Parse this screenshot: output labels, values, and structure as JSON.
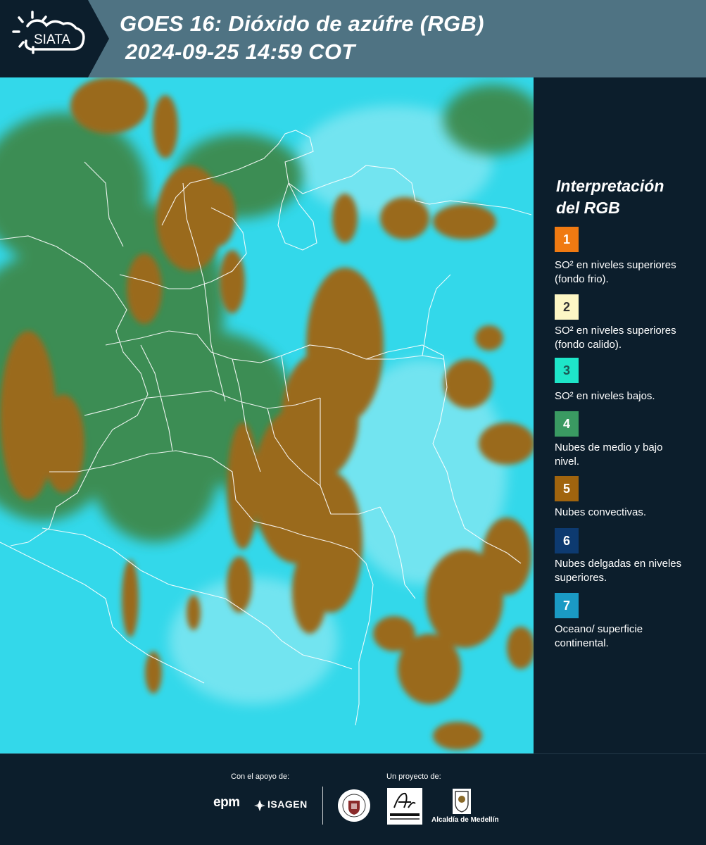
{
  "header": {
    "logo_text": "SIATA",
    "title_line1": "GOES 16: Dióxido de azúfre (RGB)",
    "title_line2": "2024-09-25 14:59 COT",
    "background_color": "#4f7383",
    "tab_color": "#0c1e2c"
  },
  "legend": {
    "title_line1": "Interpretación",
    "title_line2": "del RGB",
    "items": [
      {
        "number": "1",
        "label": "SO² en niveles superiores (fondo frio).",
        "color": "#f07a12",
        "text_color": "#ffffff"
      },
      {
        "number": "2",
        "label": "SO² en niveles superiores (fondo calido).",
        "color": "#fdf7c5",
        "text_color": "#333333"
      },
      {
        "number": "3",
        "label": "SO² en niveles bajos.",
        "color": "#1ee6c9",
        "text_color": "#1b5a55"
      },
      {
        "number": "4",
        "label": "Nubes de medio y bajo nivel.",
        "color": "#3a9a62",
        "text_color": "#ffffff"
      },
      {
        "number": "5",
        "label": "Nubes convectivas.",
        "color": "#a0640e",
        "text_color": "#ffffff"
      },
      {
        "number": "6",
        "label": "Nubes delgadas en niveles superiores.",
        "color": "#0d3a70",
        "text_color": "#ffffff"
      },
      {
        "number": "7",
        "label": "Oceano/ superficie continental.",
        "color": "#1a9ac4",
        "text_color": "#ffffff"
      }
    ]
  },
  "map": {
    "ocean_color": "#33d8ea",
    "convective_color": "#9a6a1c",
    "green_color": "#3c8a4e",
    "border_color": "#ffffff"
  },
  "footer": {
    "support_label": "Con el apoyo de:",
    "project_label": "Un proyecto de:",
    "epm_logo": "epm",
    "isagen_logo": "ISAGEN",
    "metropolitana_logo": "Área Metropolitana Valle de Aburrá",
    "alcaldia_label": "Alcaldía de Medellín"
  }
}
